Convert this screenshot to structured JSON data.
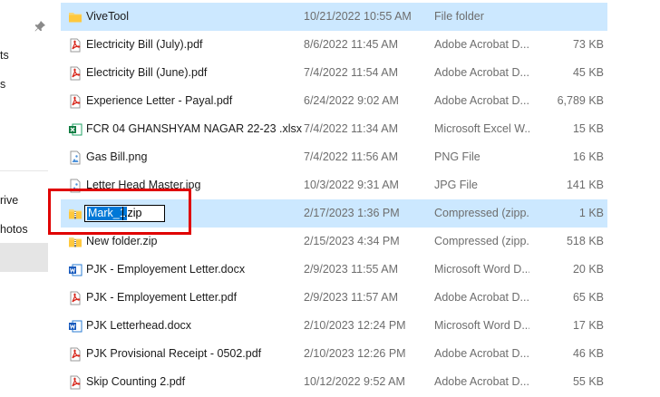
{
  "sidebar": {
    "labels": [
      "ts",
      "s",
      "rive",
      "hotos"
    ]
  },
  "files": [
    {
      "name": "ViveTool",
      "date": "10/21/2022 10:55 AM",
      "type": "File folder",
      "size": "",
      "icon": "folder-icon",
      "state": "selected"
    },
    {
      "name": "Electricity Bill (July).pdf",
      "date": "8/6/2022 11:45 AM",
      "type": "Adobe Acrobat D...",
      "size": "73 KB",
      "icon": "pdf-icon",
      "state": ""
    },
    {
      "name": "Electricity Bill (June).pdf",
      "date": "7/4/2022 11:54 AM",
      "type": "Adobe Acrobat D...",
      "size": "45 KB",
      "icon": "pdf-icon",
      "state": ""
    },
    {
      "name": "Experience Letter - Payal.pdf",
      "date": "6/24/2022 9:02 AM",
      "type": "Adobe Acrobat D...",
      "size": "6,789 KB",
      "icon": "pdf-icon",
      "state": ""
    },
    {
      "name": "FCR 04 GHANSHYAM NAGAR 22-23 .xlsx",
      "date": "7/4/2022 11:34 AM",
      "type": "Microsoft Excel W...",
      "size": "15 KB",
      "icon": "excel-icon",
      "state": ""
    },
    {
      "name": "Gas Bill.png",
      "date": "7/4/2022 11:56 AM",
      "type": "PNG File",
      "size": "16 KB",
      "icon": "image-icon",
      "state": ""
    },
    {
      "name": "Letter Head Master.jpg",
      "date": "10/3/2022 9:31 AM",
      "type": "JPG File",
      "size": "141 KB",
      "icon": "image-icon",
      "state": ""
    },
    {
      "name": "Mark_1.zip",
      "date": "2/17/2023 1:36 PM",
      "type": "Compressed (zipp...",
      "size": "1 KB",
      "icon": "zip-folder-icon",
      "state": "renaming"
    },
    {
      "name": "New folder.zip",
      "date": "2/15/2023 4:34 PM",
      "type": "Compressed (zipp...",
      "size": "518 KB",
      "icon": "zip-folder-icon",
      "state": ""
    },
    {
      "name": "PJK - Employement Letter.docx",
      "date": "2/9/2023 11:55 AM",
      "type": "Microsoft Word D...",
      "size": "20 KB",
      "icon": "word-icon",
      "state": ""
    },
    {
      "name": "PJK - Employement Letter.pdf",
      "date": "2/9/2023 11:57 AM",
      "type": "Adobe Acrobat D...",
      "size": "65 KB",
      "icon": "pdf-icon",
      "state": ""
    },
    {
      "name": "PJK Letterhead.docx",
      "date": "2/10/2023 12:24 PM",
      "type": "Microsoft Word D...",
      "size": "17 KB",
      "icon": "word-icon",
      "state": ""
    },
    {
      "name": "PJK Provisional Receipt - 0502.pdf",
      "date": "2/10/2023 12:26 PM",
      "type": "Adobe Acrobat D...",
      "size": "46 KB",
      "icon": "pdf-icon",
      "state": ""
    },
    {
      "name": "Skip Counting 2.pdf",
      "date": "10/12/2022 9:52 AM",
      "type": "Adobe Acrobat D...",
      "size": "55 KB",
      "icon": "pdf-icon",
      "state": ""
    }
  ],
  "rename": {
    "selected_text": "Mark_1",
    "rest_text": ".zip"
  },
  "colors": {
    "selection": "#cce8ff",
    "annotation": "#e00000",
    "text_selection": "#0078d7"
  }
}
